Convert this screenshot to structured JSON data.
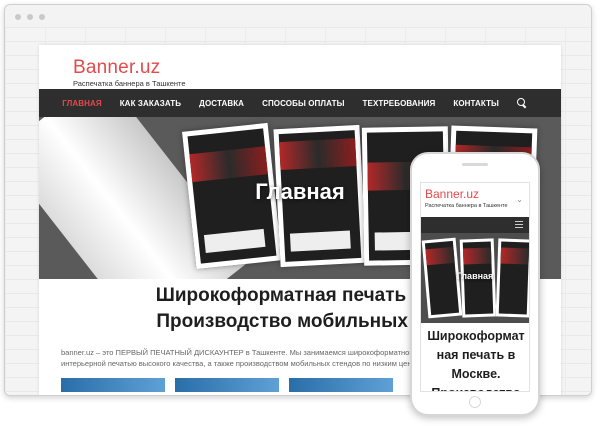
{
  "site": {
    "brand": "Banner.uz",
    "tagline": "Распечатка баннера в Ташкенте"
  },
  "nav": {
    "items": [
      {
        "label": "ГЛАВНАЯ",
        "active": true
      },
      {
        "label": "КАК ЗАКАЗАТЬ",
        "active": false
      },
      {
        "label": "ДОСТАВКА",
        "active": false
      },
      {
        "label": "СПОСОБЫ ОПЛАТЫ",
        "active": false
      },
      {
        "label": "ТЕХТРЕБОВАНИЯ",
        "active": false
      },
      {
        "label": "КОНТАКТЫ",
        "active": false
      }
    ],
    "search_icon": "search-icon"
  },
  "hero": {
    "title": "Главная"
  },
  "main": {
    "heading_line1": "Широкоформатная печать в М",
    "heading_line2": "Производство мобильных сте",
    "intro_line1": "banner.uz – это ПЕРВЫЙ ПЕЧАТНЫЙ ДИСКАУНТЕР в Ташкенте. Мы занимаемся широкоформатной печатью",
    "intro_line2": "интерьерной печатью высокого качества, а также производством мобильных стендов по низким ценам."
  },
  "phone": {
    "brand": "Banner.uz",
    "tagline": "Распечатка баннера в Ташкенте",
    "hero_title": "Главная",
    "heading_line1": "Широкоформат",
    "heading_line2": "ная печать в",
    "heading_line3": "Москве.",
    "heading_line4": "Производство"
  },
  "colors": {
    "accent": "#e24b4b",
    "nav_bg": "#2e2e2e"
  }
}
